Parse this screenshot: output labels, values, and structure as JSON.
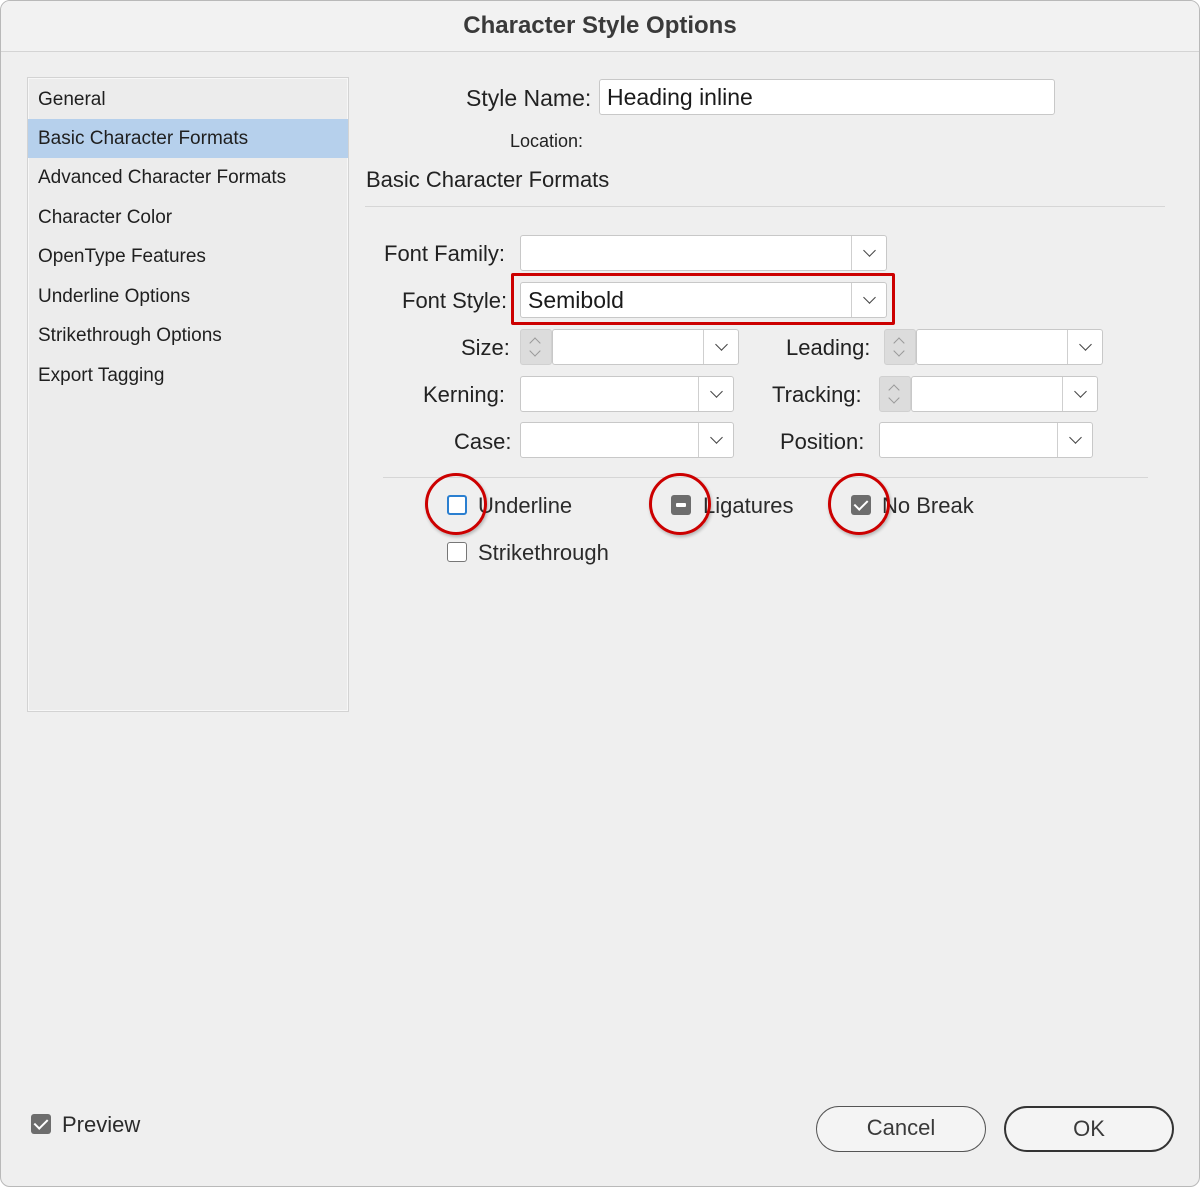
{
  "window": {
    "title": "Character Style Options"
  },
  "sidebar": {
    "items": [
      {
        "label": "General",
        "selected": false
      },
      {
        "label": "Basic Character Formats",
        "selected": true
      },
      {
        "label": "Advanced Character Formats",
        "selected": false
      },
      {
        "label": "Character Color",
        "selected": false
      },
      {
        "label": "OpenType Features",
        "selected": false
      },
      {
        "label": "Underline Options",
        "selected": false
      },
      {
        "label": "Strikethrough Options",
        "selected": false
      },
      {
        "label": "Export Tagging",
        "selected": false
      }
    ]
  },
  "header": {
    "style_name_label": "Style Name:",
    "style_name_value": "Heading inline",
    "location_label": "Location:",
    "section_title": "Basic Character Formats"
  },
  "fields": {
    "font_family": {
      "label": "Font Family:",
      "value": ""
    },
    "font_style": {
      "label": "Font Style:",
      "value": "Semibold"
    },
    "size": {
      "label": "Size:",
      "value": ""
    },
    "leading": {
      "label": "Leading:",
      "value": ""
    },
    "kerning": {
      "label": "Kerning:",
      "value": ""
    },
    "tracking": {
      "label": "Tracking:",
      "value": ""
    },
    "case": {
      "label": "Case:",
      "value": ""
    },
    "position": {
      "label": "Position:",
      "value": ""
    }
  },
  "checkboxes": {
    "underline": {
      "label": "Underline",
      "state": "unchecked"
    },
    "ligatures": {
      "label": "Ligatures",
      "state": "mixed"
    },
    "no_break": {
      "label": "No Break",
      "state": "checked"
    },
    "strikethrough": {
      "label": "Strikethrough",
      "state": "unchecked"
    }
  },
  "footer": {
    "preview_label": "Preview",
    "preview_checked": true,
    "cancel_label": "Cancel",
    "ok_label": "OK"
  },
  "colors": {
    "highlight": "#cc0000",
    "selection": "#b6d0ec",
    "focus_blue": "#2b7fd0"
  }
}
